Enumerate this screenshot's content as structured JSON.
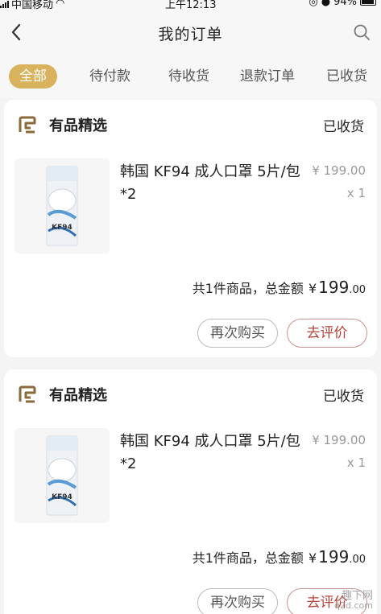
{
  "status_bar": {
    "carrier": "中国移动",
    "time": "上午12:13",
    "battery": "94%"
  },
  "nav": {
    "title": "我的订单",
    "back_icon": "chevron-left-icon",
    "search_icon": "search-icon"
  },
  "tabs": [
    {
      "label": "全部",
      "active": true
    },
    {
      "label": "待付款",
      "active": false
    },
    {
      "label": "待收货",
      "active": false
    },
    {
      "label": "退款订单",
      "active": false
    },
    {
      "label": "已收货",
      "active": false
    }
  ],
  "colors": {
    "accent": "#d9b25e",
    "review_red": "#b8413a",
    "brand_icon": "#8a6a3a",
    "muted": "#999999",
    "background": "#f4f4f4"
  },
  "orders": [
    {
      "store_name": "有品精选",
      "status": "已收货",
      "product_name": "韩国 KF94 成人口罩 5片/包*2",
      "product_price": "¥ 199.00",
      "product_qty": "x 1",
      "thumb_text": "KF94",
      "summary_label": "共1件商品，总金额",
      "currency": "¥",
      "total_int": "199",
      "total_dec": ".00",
      "rebuy_label": "再次购买",
      "review_label": "去评价"
    },
    {
      "store_name": "有品精选",
      "status": "已收货",
      "product_name": "韩国 KF94 成人口罩 5片/包*2",
      "product_price": "¥ 199.00",
      "product_qty": "x 1",
      "thumb_text": "KF94",
      "summary_label": "共1件商品，总金额",
      "currency": "¥",
      "total_int": "199",
      "total_dec": ".00",
      "rebuy_label": "再次购买",
      "review_label": "去评价"
    }
  ],
  "watermark": {
    "text": "趣下网",
    "url": "q2d.com"
  }
}
